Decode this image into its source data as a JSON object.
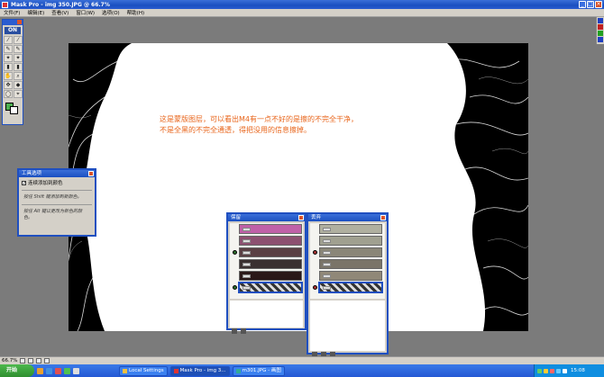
{
  "window": {
    "title": "Mask Pro - img 350.JPG @ 66.7%"
  },
  "menu": [
    "文件(F)",
    "编辑(E)",
    "查看(V)",
    "窗口(W)",
    "选项(O)",
    "帮助(H)"
  ],
  "toolbox": {
    "logo": "ON",
    "tools": [
      "dropper-add",
      "dropper-subtract",
      "magic-brush",
      "magic-pen",
      "brush",
      "pen",
      "eraser",
      "fill",
      "hand",
      "zoom",
      "move",
      "bucket",
      "lasso",
      "selector"
    ]
  },
  "tool_options": {
    "title": "工具选项",
    "checkbox_label": "连续添加到颜色",
    "hint1": "按住 Shift 键添加到新颜色。",
    "hint2": "按住 Alt 键以更改为新色的颜色。"
  },
  "annotation": {
    "line1": "这是蒙版图层，可以看出M4有一点不好的是擦的不完全干净，",
    "line2": "不是全黑的不完全通透，得把没用的信息擦掉。"
  },
  "layers_left": {
    "title": "保留",
    "swatches": [
      {
        "color": "#c060a8",
        "visible": false
      },
      {
        "color": "#8c5070",
        "visible": false
      },
      {
        "color": "#5a4044",
        "visible": true
      },
      {
        "color": "#3a3030",
        "visible": false
      },
      {
        "color": "#2a1818",
        "visible": false
      },
      {
        "color": "hatch",
        "visible": true,
        "selected": true
      }
    ]
  },
  "layers_right": {
    "title": "丢弃",
    "swatches": [
      {
        "color": "#b0b0a0",
        "visible": false
      },
      {
        "color": "#a0a090",
        "visible": false
      },
      {
        "color": "#8a8678",
        "visible": true
      },
      {
        "color": "#7a7468",
        "visible": false
      },
      {
        "color": "#908878",
        "visible": false
      },
      {
        "color": "hatch",
        "visible": true,
        "selected": true
      }
    ]
  },
  "status": {
    "zoom": "66.7%"
  },
  "taskbar": {
    "start": "开始",
    "tasks": [
      {
        "label": "Local Settings",
        "active": false
      },
      {
        "label": "Mask Pro - img 3...",
        "active": true
      },
      {
        "label": "m301.JPG - 画图",
        "active": false
      }
    ],
    "clock": "15:08"
  }
}
